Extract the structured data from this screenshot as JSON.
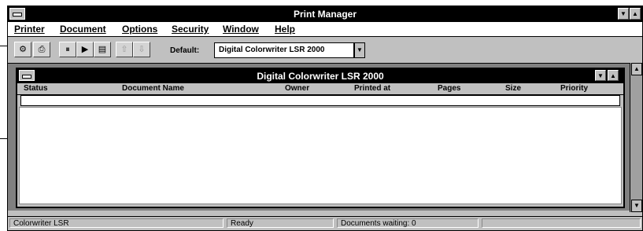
{
  "app": {
    "title": "Print Manager",
    "minimize_glyph": "▼",
    "maximize_glyph": "▲"
  },
  "menu": [
    "Printer",
    "Document",
    "Options",
    "Security",
    "Window",
    "Help"
  ],
  "toolbar": {
    "buttons": [
      {
        "icon": "printer-properties-icon",
        "glyph": "⚙",
        "enabled": true
      },
      {
        "icon": "printer-connect-icon",
        "glyph": "⎙",
        "enabled": true
      },
      {
        "icon": "pause-printer-icon",
        "glyph": "⏸",
        "enabled": true
      },
      {
        "icon": "resume-printer-icon",
        "glyph": "▶",
        "enabled": true
      },
      {
        "icon": "printer-details-icon",
        "glyph": "▤",
        "enabled": true
      },
      {
        "icon": "move-document-up-icon",
        "glyph": "⇧",
        "enabled": false
      },
      {
        "icon": "move-document-down-icon",
        "glyph": "⇩",
        "enabled": false
      }
    ],
    "default_label": "Default:",
    "default_printer": "Digital Colorwriter LSR 2000",
    "dropdown_glyph": "▼"
  },
  "queue_window": {
    "title": "Digital Colorwriter LSR 2000",
    "columns": [
      "Status",
      "Document Name",
      "Owner",
      "Printed at",
      "Pages",
      "Size",
      "Priority"
    ]
  },
  "scrollbar": {
    "up_glyph": "▲",
    "down_glyph": "▼"
  },
  "statusbar": {
    "printer": "Colorwriter LSR",
    "state": "Ready",
    "documents_waiting": "Documents waiting: 0"
  },
  "colors": {
    "titlebar": "#000000",
    "window_face": "#c0c0c0",
    "workspace": "#808080"
  }
}
